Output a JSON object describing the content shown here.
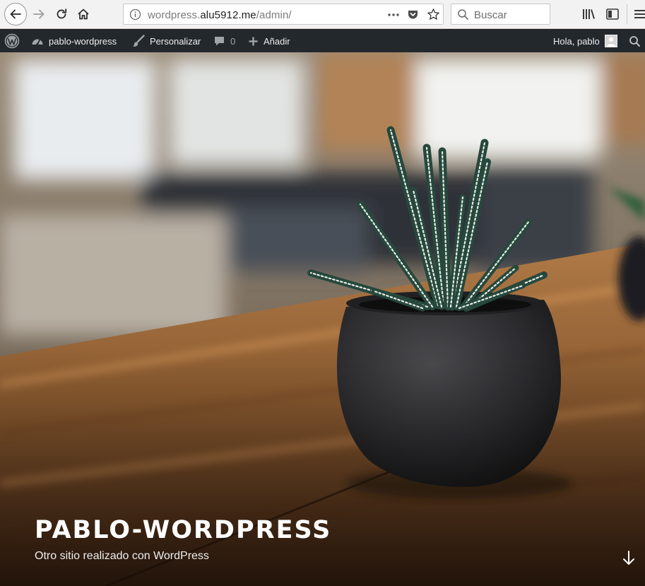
{
  "browser": {
    "url": {
      "prefix": "wordpress.",
      "domain": "alu5912.me",
      "path": "/admin/"
    },
    "more_label": "•••",
    "search_placeholder": "Buscar",
    "icons": {
      "back": "back-arrow-icon",
      "forward": "forward-arrow-icon",
      "reload": "reload-icon",
      "home": "home-icon",
      "info": "info-icon",
      "pocket": "pocket-icon",
      "bookmark": "star-icon",
      "search": "search-icon",
      "library": "library-icon",
      "sidebar": "sidebar-icon",
      "menu": "hamburger-menu-icon"
    }
  },
  "adminbar": {
    "site_name": "pablo-wordpress",
    "customize": "Personalizar",
    "comments_count": "0",
    "new": "Añadir",
    "greeting": "Hola, pablo",
    "icons": {
      "logo": "wordpress-logo-icon",
      "dashboard": "dashboard-icon",
      "customize": "brush-icon",
      "comments": "comment-icon",
      "new": "plus-icon",
      "search": "search-icon"
    },
    "colors": {
      "background": "#23282d",
      "text": "#eeeeee"
    }
  },
  "hero": {
    "site_title": "PABLO-WORDPRESS",
    "tagline": "Otro sitio realizado con WordPress",
    "scroll_icon": "arrow-down-icon"
  }
}
